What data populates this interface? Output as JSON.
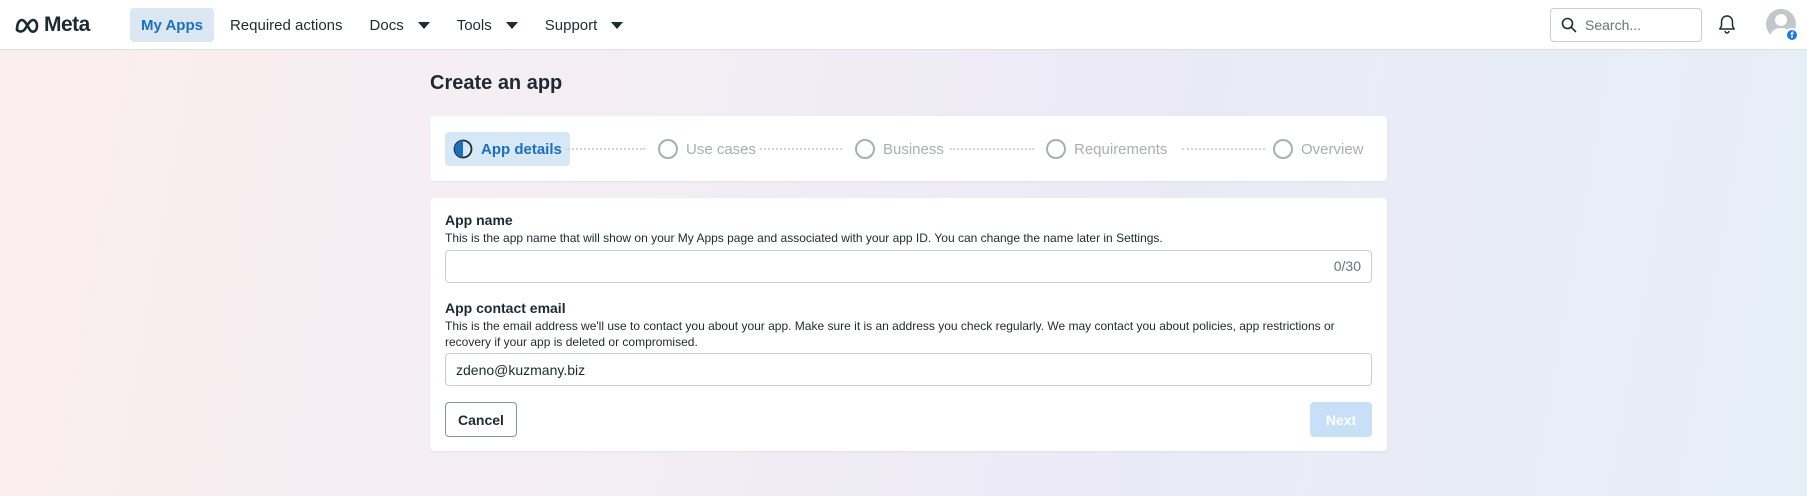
{
  "brand": {
    "name": "Meta"
  },
  "nav": {
    "items": [
      {
        "label": "My Apps",
        "active": true,
        "dropdown": false
      },
      {
        "label": "Required actions",
        "active": false,
        "dropdown": false
      },
      {
        "label": "Docs",
        "active": false,
        "dropdown": true
      },
      {
        "label": "Tools",
        "active": false,
        "dropdown": true
      },
      {
        "label": "Support",
        "active": false,
        "dropdown": true
      }
    ],
    "search_placeholder": "Search..."
  },
  "page": {
    "title": "Create an app"
  },
  "stepper": {
    "steps": [
      {
        "label": "App details",
        "state": "current"
      },
      {
        "label": "Use cases",
        "state": "pending"
      },
      {
        "label": "Business",
        "state": "pending"
      },
      {
        "label": "Requirements",
        "state": "pending"
      },
      {
        "label": "Overview",
        "state": "pending"
      }
    ]
  },
  "form": {
    "app_name": {
      "label": "App name",
      "help": "This is the app name that will show on your My Apps page and associated with your app ID. You can change the name later in Settings.",
      "value": "",
      "counter": "0/30"
    },
    "contact_email": {
      "label": "App contact email",
      "help": "This is the email address we'll use to contact you about your app. Make sure it is an address you check regularly. We may contact you about policies, app restrictions or recovery if your app is deleted or compromised.",
      "value": "zdeno@kuzmany.biz"
    },
    "cancel_label": "Cancel",
    "next_label": "Next"
  },
  "colors": {
    "accent": "#1c6fb8",
    "active_bg": "#dbe7f2",
    "next_disabled_bg": "#c8e0f7",
    "text": "#1c2b33",
    "muted": "#a7afb6"
  }
}
